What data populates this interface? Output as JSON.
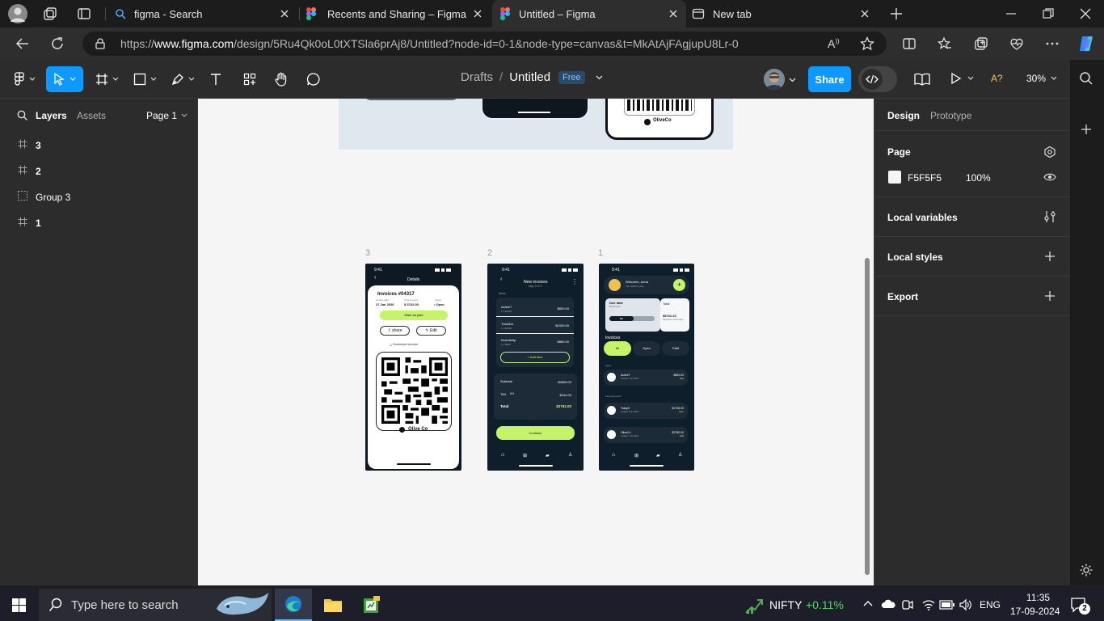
{
  "browser": {
    "tabs": [
      {
        "label": "figma - Search",
        "icon": "search-icon"
      },
      {
        "label": "Recents and Sharing – Figma",
        "icon": "figma-icon"
      },
      {
        "label": "Untitled – Figma",
        "icon": "figma-icon",
        "active": true
      },
      {
        "label": "New tab",
        "icon": "newtab-icon"
      }
    ],
    "url_prefix": "https://",
    "url_host": "www.figma.com",
    "url_path": "/design/5Ru4Qk0oL0tXTSla6prAj8/Untitled?node-id=0-1&node-type=canvas&t=MkAtAjFAgjupU8Lr-0"
  },
  "figma": {
    "breadcrumb_parent": "Drafts",
    "breadcrumb_sep": "/",
    "file_name": "Untitled",
    "plan_badge": "Free",
    "share_label": "Share",
    "a11y_label": "A?",
    "zoom": "30%",
    "accent": "#0d99ff",
    "left_panel": {
      "tab_layers": "Layers",
      "tab_assets": "Assets",
      "page_selector": "Page 1",
      "layers": [
        {
          "name": "3",
          "type": "frame"
        },
        {
          "name": "2",
          "type": "frame"
        },
        {
          "name": "Group 3",
          "type": "group"
        },
        {
          "name": "1",
          "type": "frame"
        }
      ]
    },
    "right_panel": {
      "tab_design": "Design",
      "tab_prototype": "Prototype",
      "page_title": "Page",
      "page_color": "F5F5F5",
      "page_opacity": "100%",
      "local_variables": "Local variables",
      "local_styles": "Local styles",
      "export": "Export"
    },
    "canvas": {
      "background": "#f5f5f5",
      "frame_labels": [
        "3",
        "2",
        "1"
      ],
      "screen3": {
        "time": "9:41",
        "title": "Details",
        "invoice_no": "Invoices #04317",
        "issue_label": "invoice date",
        "issue_value": "27 Jan 2026",
        "amount_label": "Total amount",
        "amount_value": "$ 3762.00",
        "status_label": "status",
        "status_value": "• Open",
        "mark_paid": "Mark as paid",
        "share": "share",
        "edit": "Edit",
        "download": "Download receipt",
        "brand": "Olive Co"
      },
      "screen2": {
        "time": "9:41",
        "title": "New invoices",
        "subtitle": "step 2 of 3",
        "items_header": "Items",
        "items": [
          {
            "name": "ActiveT",
            "qty": "1 x $2000",
            "price": "$800.00"
          },
          {
            "name": "TrackDo",
            "qty": "1 x $1000",
            "price": "$1000.00"
          },
          {
            "name": "Incentship",
            "qty": "1 x $880",
            "price": "$880.00"
          }
        ],
        "add_item": "+ Add item",
        "subtotal_label": "Subtotal",
        "subtotal_value": "$3608.00",
        "tax_label": "TAX",
        "tax_rate": "8%",
        "tax_value": "$104.00",
        "total_label": "Total",
        "total_value": "$3762.00",
        "continue": "Continue"
      },
      "screen1": {
        "time": "9:41",
        "greeting": "Welcome, Anna",
        "greeting_sub": "Your wallet today",
        "due_label": "Due date",
        "due_sub": "Reference",
        "due_chip": "8/8",
        "total_label": "Total",
        "total_value": "$5731.23",
        "total_sub": "Payment in 10/10 days",
        "section": "Invoices",
        "filters": [
          "All",
          "Open",
          "Paid"
        ],
        "group1": "Open",
        "group2": "Last payments",
        "rows": [
          {
            "name": "ActiveT",
            "date": "Created 7 Jan 2024",
            "amount": "$983.00",
            "status": "Paid"
          },
          {
            "name": "TrakyD",
            "date": "Created 3 Jan 2024",
            "amount": "$1728.00",
            "status": "Open"
          },
          {
            "name": "OliveCo",
            "date": "Created 1 Jan 2024",
            "amount": "$2780.00",
            "status": "Paid"
          }
        ]
      },
      "top_preview_brand": "OliveCo"
    }
  },
  "taskbar": {
    "search_placeholder": "Type here to search",
    "stock_name": "NIFTY",
    "stock_change": "+0.11%",
    "language": "ENG",
    "time": "11:35",
    "date": "17-09-2024",
    "notification_count": "2"
  }
}
